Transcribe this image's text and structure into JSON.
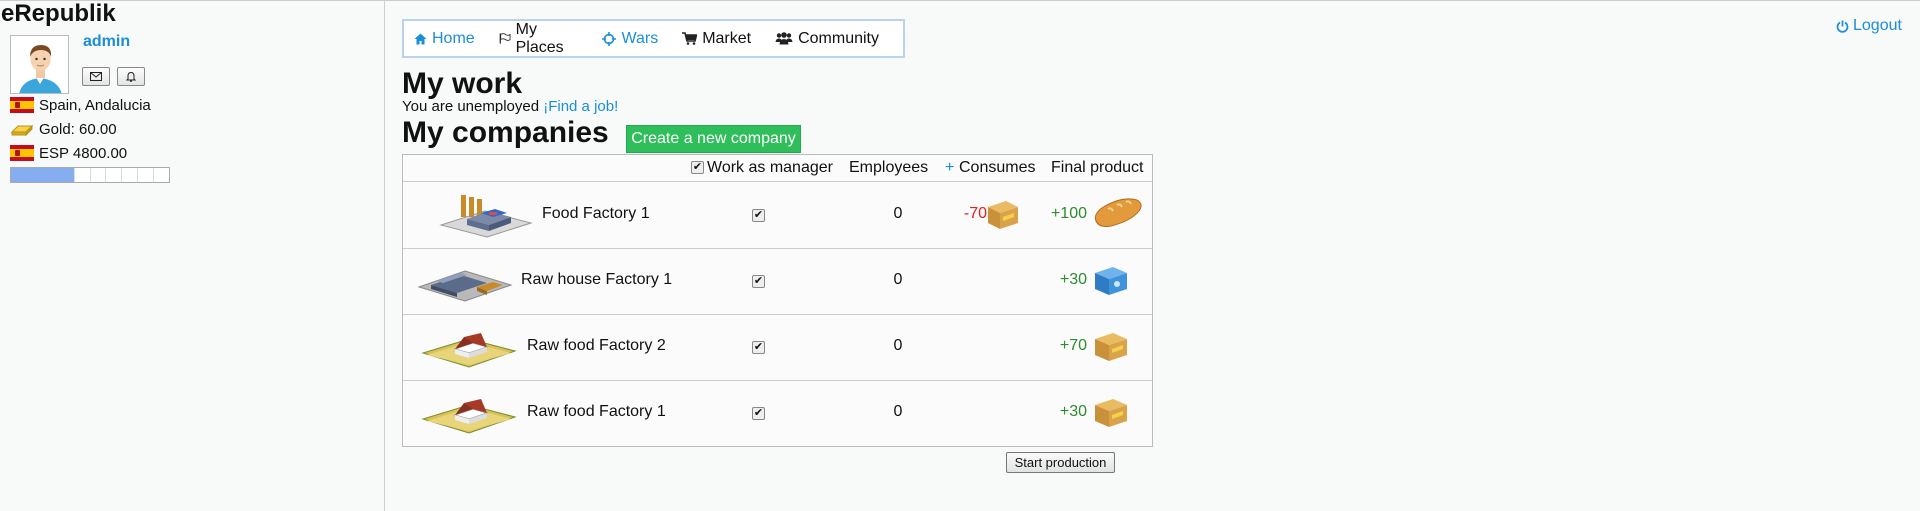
{
  "app": {
    "title": "eRepublik"
  },
  "user": {
    "name": "admin",
    "location": "Spain, Andalucia",
    "gold": "Gold: 60.00",
    "currency": "ESP 4800.00",
    "xp_progress": 0.4
  },
  "nav": {
    "items": [
      {
        "label": "Home",
        "icon": "home-icon"
      },
      {
        "label": "My Places",
        "icon": "flag-icon"
      },
      {
        "label": "Wars",
        "icon": "crosshair-icon"
      },
      {
        "label": "Market",
        "icon": "cart-icon"
      },
      {
        "label": "Community",
        "icon": "users-icon"
      }
    ],
    "logout": "Logout"
  },
  "work": {
    "heading": "My work",
    "status_prefix": "You are unemployed ",
    "find_job": "¡Find a job!"
  },
  "companies": {
    "heading": "My companies",
    "create_label": "Create a new company",
    "columns": {
      "manager": "Work as manager",
      "employees": "Employees",
      "consumes_plus": "+",
      "consumes": "Consumes",
      "final": "Final product"
    },
    "rows": [
      {
        "name": "Food Factory 1",
        "employees": "0",
        "consumes": "-70",
        "product": "+100",
        "checked": true
      },
      {
        "name": "Raw house Factory 1",
        "employees": "0",
        "consumes": "",
        "product": "+30",
        "checked": true
      },
      {
        "name": "Raw food Factory 2",
        "employees": "0",
        "consumes": "",
        "product": "+70",
        "checked": true
      },
      {
        "name": "Raw food Factory 1",
        "employees": "0",
        "consumes": "",
        "product": "+30",
        "checked": true
      }
    ],
    "start_label": "Start production"
  },
  "colors": {
    "accent": "#1a8fd8",
    "create": "#2fbf5a",
    "negative": "#e21d1d",
    "positive": "#2e8b2e"
  }
}
